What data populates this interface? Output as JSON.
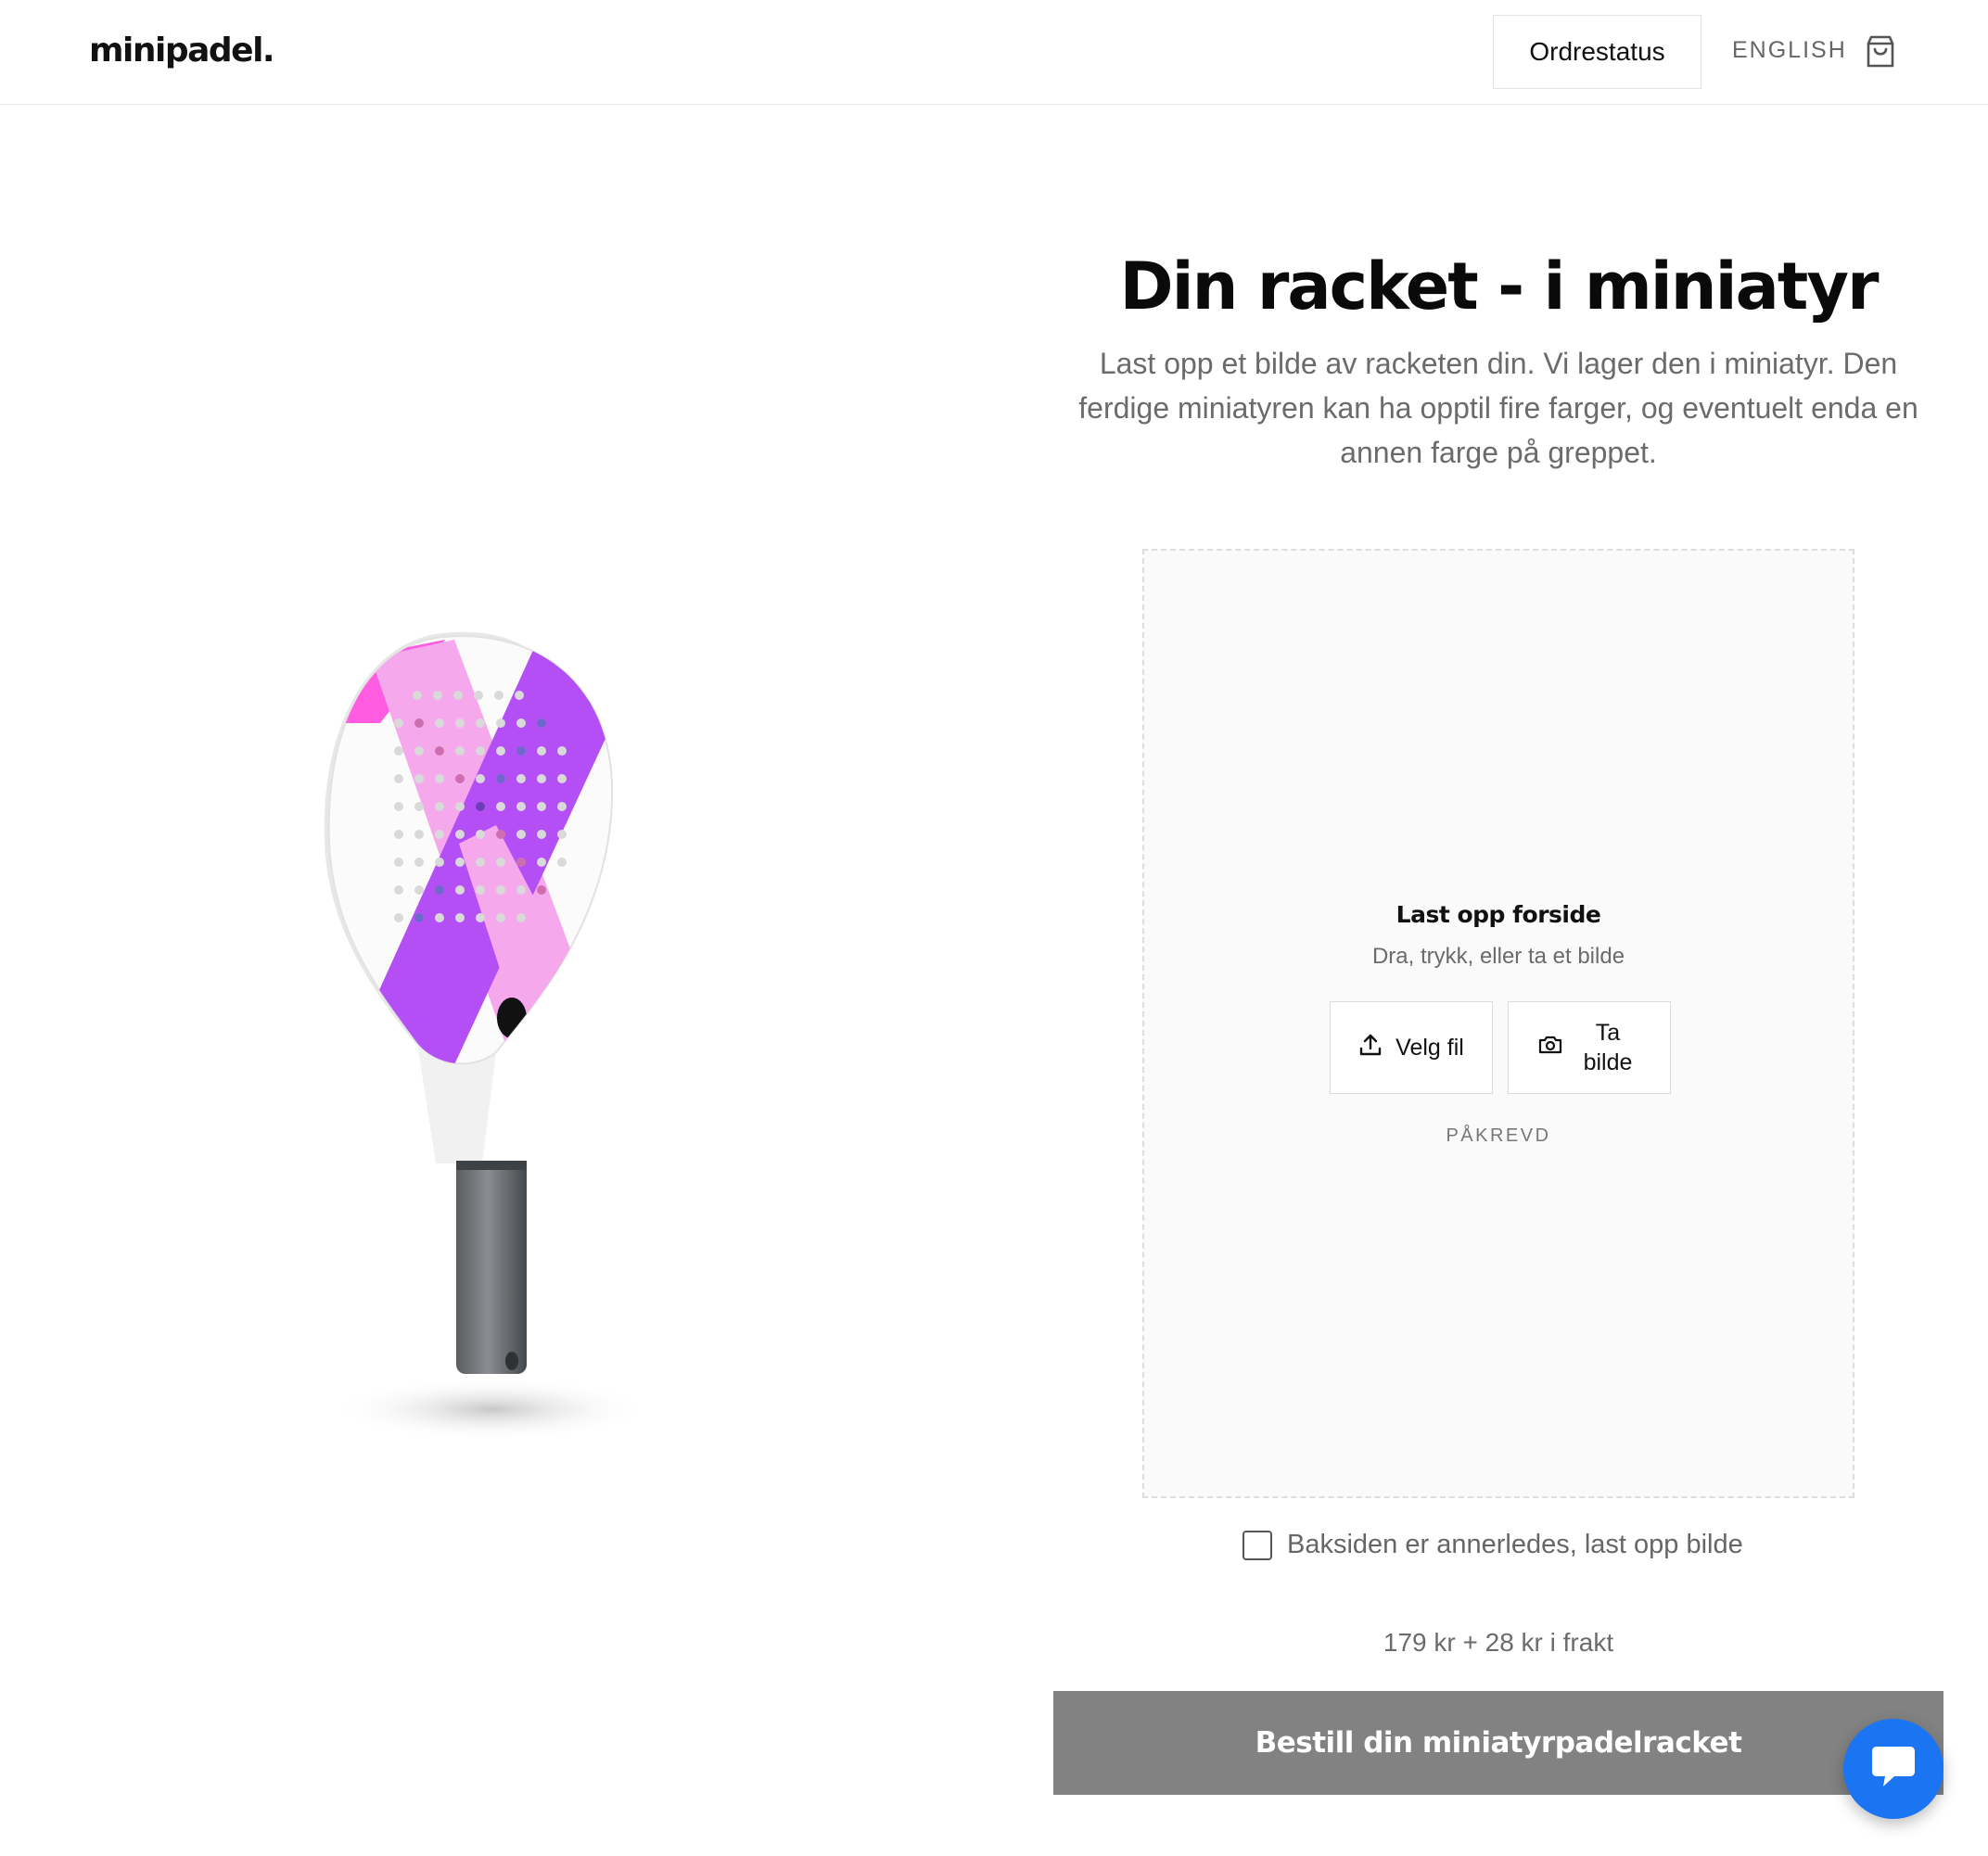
{
  "header": {
    "logo": "minipadel.",
    "order_status": "Ordrestatus",
    "language": "ENGLISH",
    "cart_icon": "shopping-bag-icon"
  },
  "hero": {
    "title": "Din racket - i miniatyr",
    "subtitle": "Last opp et bilde av racketen din. Vi lager den i miniatyr. Den ferdige miniatyren kan ha opptil fire farger, og eventuelt enda en annen farge på greppet."
  },
  "upload": {
    "title": "Last opp forside",
    "hint": "Dra, trykk, eller ta et bilde",
    "choose_file": "Velg fil",
    "take_photo": "Ta bilde",
    "required": "PÅKREVD"
  },
  "backside": {
    "label": "Baksiden er annerledes, last opp bilde",
    "checked": false
  },
  "price": "179 kr + 28 kr i frakt",
  "order_button": "Bestill din miniatyrpadelracket",
  "colors": {
    "order_button_bg": "#828282",
    "chat_bubble": "#1b74f2",
    "racket_pink": "#f6a8ec",
    "racket_purple": "#b44ef5",
    "racket_blue": "#4530e6",
    "racket_magenta": "#ff5ce1"
  }
}
